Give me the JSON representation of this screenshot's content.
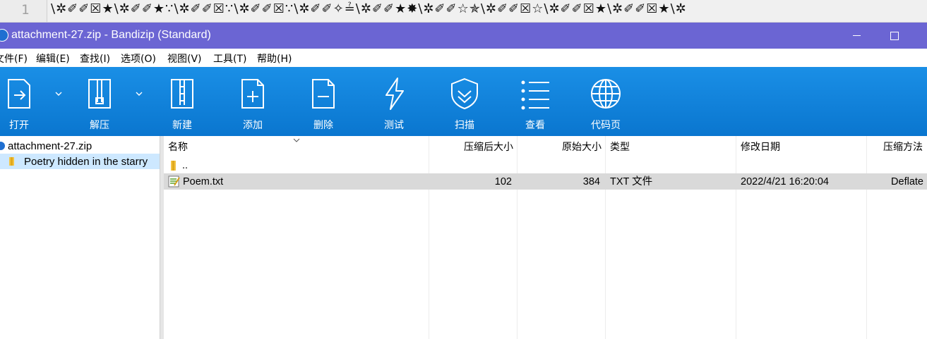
{
  "editor": {
    "line_number": "1",
    "content": "\\✲✐✐☒★\\✲✐✐★∵\\✲✐✐☒∵\\✲✐✐☒∵\\✲✐✐✧≟\\✲✐✐★✸\\✲✐✐☆✯\\✲✐✐☒☆\\✲✐✐☒★\\✲✐✐☒★\\✲"
  },
  "window": {
    "title": "attachment-27.zip - Bandizip (Standard)",
    "title_color": "#6b65d3"
  },
  "menu": [
    "文件(F)",
    "编辑(E)",
    "查找(I)",
    "选项(O)",
    "视图(V)",
    "工具(T)",
    "帮助(H)"
  ],
  "toolbar": {
    "buttons": [
      {
        "label": "打开",
        "icon": "open-icon"
      },
      {
        "label": "解压",
        "icon": "extract-icon"
      },
      {
        "label": "新建",
        "icon": "new-archive-icon"
      },
      {
        "label": "添加",
        "icon": "add-file-icon"
      },
      {
        "label": "删除",
        "icon": "delete-file-icon"
      },
      {
        "label": "测试",
        "icon": "test-lightning-icon"
      },
      {
        "label": "扫描",
        "icon": "scan-shield-icon"
      },
      {
        "label": "查看",
        "icon": "view-list-icon"
      },
      {
        "label": "代码页",
        "icon": "codepage-globe-icon"
      }
    ],
    "accent": "#0a7fd8"
  },
  "tree": {
    "root": "attachment-27.zip",
    "folder": "Poetry hidden in the starry"
  },
  "list": {
    "columns": [
      "名称",
      "压缩后大小",
      "原始大小",
      "类型",
      "修改日期",
      "压缩方法"
    ],
    "rows": [
      {
        "name": "..",
        "packed": "",
        "size": "",
        "type": "",
        "modified": "",
        "method": ""
      },
      {
        "name": "Poem.txt",
        "packed": "102",
        "size": "384",
        "type": "TXT 文件",
        "modified": "2022/4/21 16:20:04",
        "method": "Deflate"
      }
    ]
  }
}
